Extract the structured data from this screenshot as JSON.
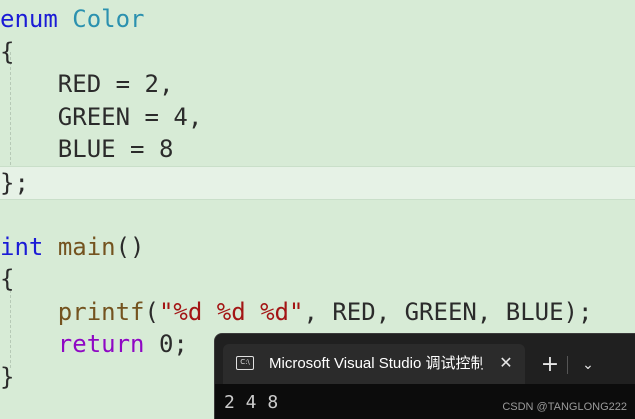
{
  "editor": {
    "lines": [
      [
        {
          "t": "enum",
          "c": "kw"
        },
        {
          "t": " ",
          "c": "plain"
        },
        {
          "t": "Color",
          "c": "type"
        }
      ],
      [
        {
          "t": "{",
          "c": "plain"
        }
      ],
      [
        {
          "t": "    RED = 2,",
          "c": "plain"
        }
      ],
      [
        {
          "t": "    GREEN = 4,",
          "c": "plain"
        }
      ],
      [
        {
          "t": "    BLUE = 8",
          "c": "plain"
        }
      ],
      [
        {
          "t": "};",
          "c": "plain"
        }
      ],
      [
        {
          "t": "",
          "c": "plain"
        }
      ],
      [
        {
          "t": "int",
          "c": "kw"
        },
        {
          "t": " ",
          "c": "plain"
        },
        {
          "t": "main",
          "c": "fn"
        },
        {
          "t": "()",
          "c": "plain"
        }
      ],
      [
        {
          "t": "{",
          "c": "plain"
        }
      ],
      [
        {
          "t": "    ",
          "c": "plain"
        },
        {
          "t": "printf",
          "c": "fn"
        },
        {
          "t": "(",
          "c": "plain"
        },
        {
          "t": "\"%d %d %d\"",
          "c": "str"
        },
        {
          "t": ", RED, GREEN, BLUE);",
          "c": "plain"
        }
      ],
      [
        {
          "t": "    ",
          "c": "plain"
        },
        {
          "t": "return",
          "c": "ctrl"
        },
        {
          "t": " 0;",
          "c": "plain"
        }
      ],
      [
        {
          "t": "}",
          "c": "plain"
        }
      ]
    ],
    "current_line": 5
  },
  "terminal": {
    "icon": "console-icon",
    "icon_text": "C:\\",
    "tab_title": "Microsoft Visual Studio 调试控制台",
    "close_glyph": "✕",
    "new_tab_glyph": "+",
    "dropdown_glyph": "⌄",
    "output": "2 4 8"
  },
  "watermark": "CSDN @TANGLONG222",
  "colors": {
    "background": "#d7ebd6",
    "keyword": "#1b1bd6",
    "type": "#2b91af",
    "function": "#74531f",
    "string": "#a31515",
    "control": "#8f08c4",
    "terminal_bg": "#202020"
  }
}
